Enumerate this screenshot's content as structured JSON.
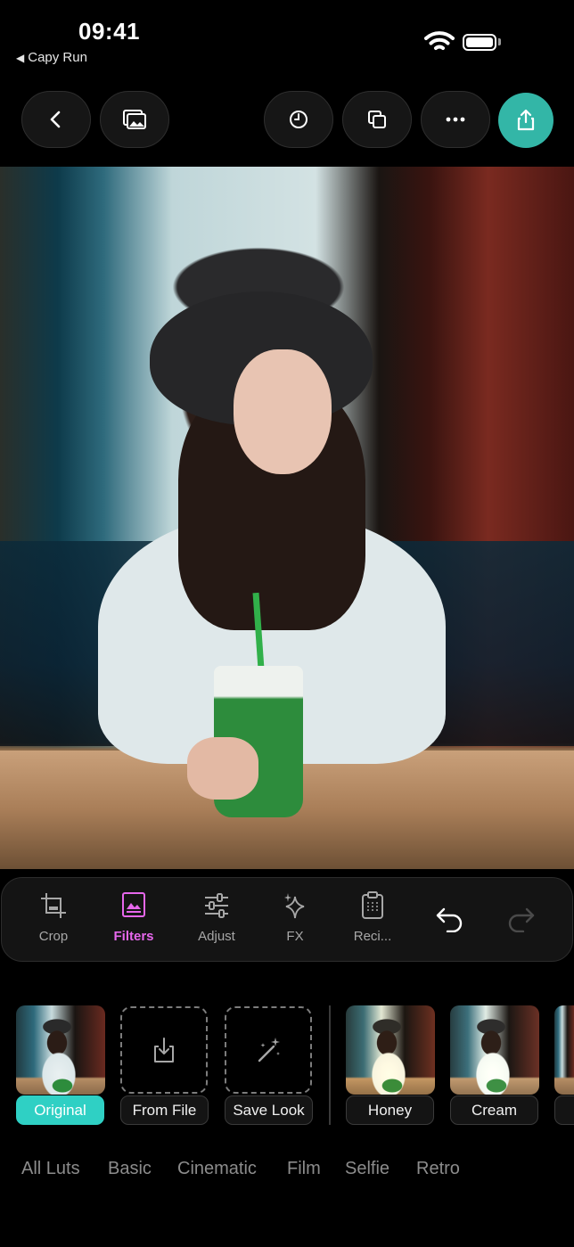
{
  "status_bar": {
    "time": "09:41",
    "back_app": "Capy Run",
    "back_arrow": "◀"
  },
  "top_bar": {
    "buttons": [
      "back-icon",
      "gallery-icon",
      "history-icon",
      "duplicate-icon",
      "more-icon",
      "share-icon"
    ],
    "accent_color": "#33b6a7"
  },
  "tools": [
    {
      "label": "Crop",
      "icon": "crop-icon",
      "active": false
    },
    {
      "label": "Filters",
      "icon": "filters-icon",
      "active": true
    },
    {
      "label": "Adjust",
      "icon": "adjust-icon",
      "active": false
    },
    {
      "label": "FX",
      "icon": "sparkle-icon",
      "active": false
    },
    {
      "label": "Reci...",
      "icon": "recipe-icon",
      "active": false
    }
  ],
  "history": {
    "undo_icon": "undo-icon",
    "redo_icon": "redo-icon",
    "redo_enabled": false
  },
  "filters": {
    "items": [
      {
        "label": "Original",
        "selected": true
      },
      {
        "label": "From File",
        "icon": "import-icon"
      },
      {
        "label": "Save Look",
        "icon": "magic-wand-icon"
      },
      {
        "label": "Honey"
      },
      {
        "label": "Cream"
      }
    ],
    "selected_color": "#2fd0c4"
  },
  "categories": [
    "All Luts",
    "Basic",
    "Cinematic",
    "Film",
    "Selfie",
    "Retro"
  ],
  "colors": {
    "active_tool": "#e667ec",
    "background": "#000000"
  }
}
